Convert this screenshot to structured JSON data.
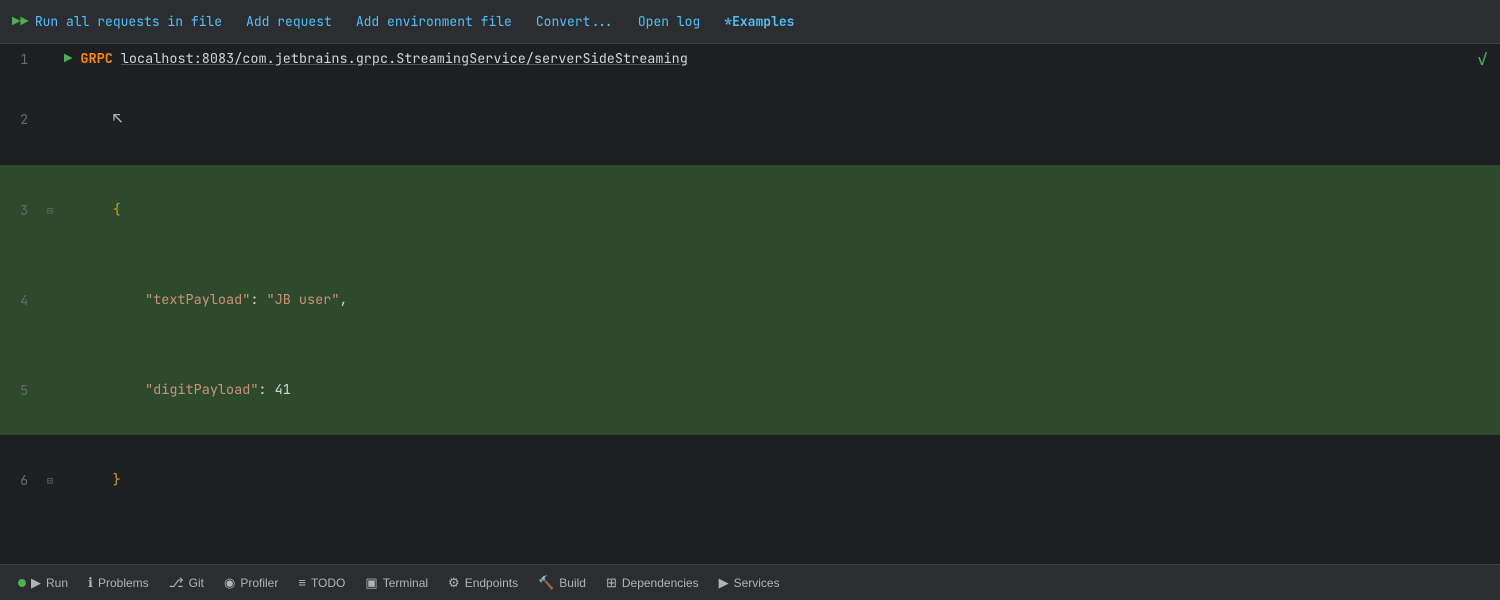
{
  "toolbar": {
    "run_all_label": "Run all requests in file",
    "add_request_label": "Add request",
    "add_env_label": "Add environment file",
    "convert_label": "Convert...",
    "open_log_label": "Open log",
    "examples_label": "*Examples"
  },
  "editor": {
    "lines": [
      {
        "number": "1",
        "type": "request",
        "grpc": "GRPC",
        "url": "localhost:8083/com.jetbrains.grpc.StreamingService/serverSideStreaming"
      },
      {
        "number": "2",
        "type": "cursor"
      },
      {
        "number": "3",
        "type": "json",
        "content": "{",
        "highlighted": true
      },
      {
        "number": "4",
        "type": "json",
        "key": "textPayload",
        "value": "\"JB user\"",
        "value_type": "string",
        "highlighted": true
      },
      {
        "number": "5",
        "type": "json",
        "key": "digitPayload",
        "value": "41",
        "value_type": "number",
        "highlighted": true
      },
      {
        "number": "6",
        "type": "json",
        "content": "}",
        "highlighted": false
      }
    ]
  },
  "statusbar": {
    "items": [
      {
        "id": "run",
        "icon": "▶",
        "label": "Run",
        "has_dot": true
      },
      {
        "id": "problems",
        "icon": "ℹ",
        "label": "Problems"
      },
      {
        "id": "git",
        "icon": "⎇",
        "label": "Git"
      },
      {
        "id": "profiler",
        "icon": "◉",
        "label": "Profiler"
      },
      {
        "id": "todo",
        "icon": "≡",
        "label": "TODO"
      },
      {
        "id": "terminal",
        "icon": "▣",
        "label": "Terminal"
      },
      {
        "id": "endpoints",
        "icon": "⚙",
        "label": "Endpoints"
      },
      {
        "id": "build",
        "icon": "🔨",
        "label": "Build"
      },
      {
        "id": "dependencies",
        "icon": "⊞",
        "label": "Dependencies"
      },
      {
        "id": "services",
        "icon": "▶",
        "label": "Services"
      }
    ]
  }
}
